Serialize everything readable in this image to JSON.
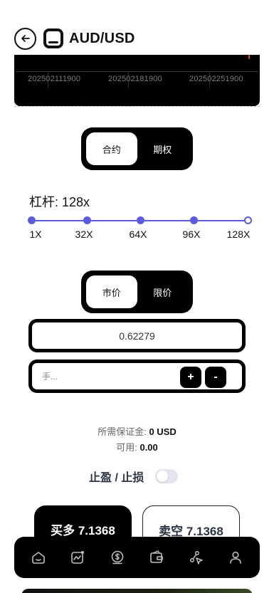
{
  "header": {
    "title": "AUD/USD"
  },
  "chart": {
    "ticks": [
      "202502111900",
      "202502181900",
      "202502251900"
    ]
  },
  "contract_tabs": [
    {
      "label": "合约",
      "active": true
    },
    {
      "label": "期权",
      "active": false
    }
  ],
  "leverage": {
    "title": "杠杆: 128x",
    "current": 128,
    "levels": [
      "1X",
      "32X",
      "64X",
      "96X",
      "128X"
    ],
    "accent_color": "#5b5be0"
  },
  "order_tabs": [
    {
      "label": "市价",
      "active": true
    },
    {
      "label": "限价",
      "active": false
    }
  ],
  "price_field": {
    "value": "0.62279"
  },
  "quantity_field": {
    "placeholder": "手...",
    "increment_label": "+",
    "decrement_label": "-"
  },
  "margin_info": {
    "required_label": "所需保证金:",
    "required_value": "0 USD",
    "available_label": "可用:",
    "available_value": "0.00"
  },
  "tpsl": {
    "label": "止盈 / 止损",
    "enabled": false
  },
  "trade_buttons": {
    "buy": "买多 7.1368",
    "sell": "卖空 7.1368"
  },
  "bottom_nav": {
    "items": [
      {
        "icon": "home-icon"
      },
      {
        "icon": "chart-icon"
      },
      {
        "icon": "dollar-coin-icon"
      },
      {
        "icon": "wallet-icon"
      },
      {
        "icon": "share-icon"
      },
      {
        "icon": "user-icon"
      }
    ]
  }
}
